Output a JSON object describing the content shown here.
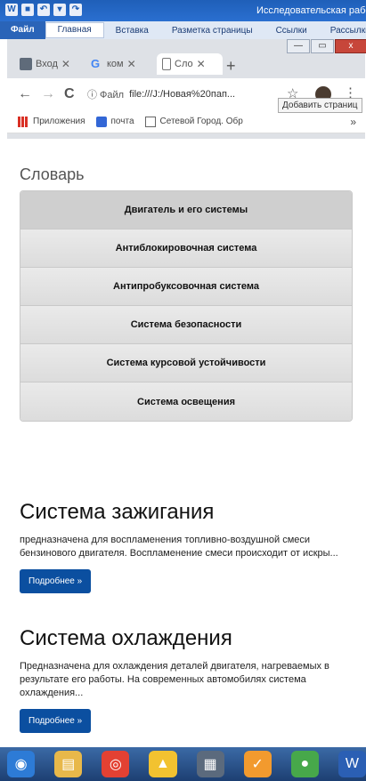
{
  "word": {
    "quick_icons": [
      "W",
      "■",
      "↶",
      "▾",
      "↷"
    ],
    "title": "Исследовательская работ",
    "tabs": [
      "Файл",
      "Главная",
      "Вставка",
      "Разметка страницы",
      "Ссылки",
      "Рассылки"
    ]
  },
  "browser": {
    "tabs": [
      {
        "label": "Вход",
        "color": "#5f6b7a"
      },
      {
        "label": "ком",
        "color": "#4285f4"
      },
      {
        "label": "Сло",
        "color": "#ffffff"
      }
    ],
    "newtab": "+",
    "window_controls": [
      "—",
      "▭",
      "x"
    ],
    "nav": {
      "back": "←",
      "forward": "→",
      "reload": "C"
    },
    "url_info": "ⓘ Файл",
    "url": "file:///J:/Новая%20пап...",
    "star": "☆",
    "menu": "⋮",
    "tooltip": "Добавить страниц",
    "bookmarks": [
      {
        "label": "Приложения",
        "icon": "apps-icon"
      },
      {
        "label": "почта",
        "icon": "mail-icon"
      },
      {
        "label": "Сетевой Город. Обр",
        "icon": "doc-icon"
      }
    ],
    "bookmarks_more": "»"
  },
  "page": {
    "dictionary_title": "Словарь",
    "accordion": [
      "Двигатель и его системы",
      "Антиблокировочная система",
      "Антипробуксовочная система",
      "Система безопасности",
      "Система курсовой устойчивости",
      "Система освещения"
    ],
    "sections": [
      {
        "title": "Система зажигания",
        "text": "предназначена для воспламенения топливно-воздушной смеси бензинового двигателя. Воспламенение смеси происходит от искры...",
        "button": "Подробнее »"
      },
      {
        "title": "Система охлаждения",
        "text": "Предназначена для охлаждения деталей двигателя, нагреваемых в результате его работы. На современных автомобилях система охлаждения...",
        "button": "Подробнее »"
      }
    ]
  },
  "taskbar": {
    "items": [
      {
        "name": "start-icon",
        "glyph": "◉",
        "color": "#2d7bd6"
      },
      {
        "name": "explorer-icon",
        "glyph": "▤",
        "color": "#e8b84a"
      },
      {
        "name": "chrome-icon",
        "glyph": "◎",
        "color": "#e34133"
      },
      {
        "name": "app-warning-icon",
        "glyph": "▲",
        "color": "#f2c230"
      },
      {
        "name": "calendar-icon",
        "glyph": "▦",
        "color": "#5b6a7d"
      },
      {
        "name": "check-icon",
        "glyph": "✓",
        "color": "#f29a2e"
      },
      {
        "name": "green-app-icon",
        "glyph": "●",
        "color": "#47a84a"
      },
      {
        "name": "word-icon",
        "glyph": "W",
        "color": "#2b5fb4"
      }
    ]
  }
}
